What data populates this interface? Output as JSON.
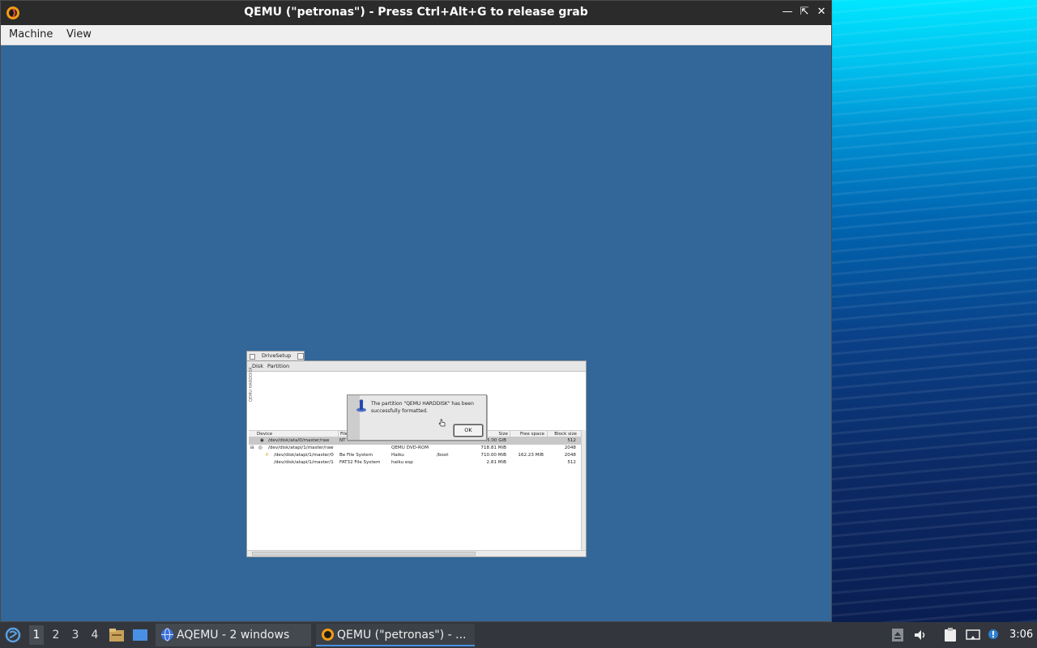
{
  "qemu_window": {
    "title": "QEMU (\"petronas\") - Press Ctrl+Alt+G to release grab",
    "menu": [
      "Machine",
      "View"
    ]
  },
  "drivesetup": {
    "title": "DriveSetup",
    "menu": [
      "Disk",
      "Partition"
    ],
    "disk_label": "QEMU HARDDISK",
    "columns": [
      "Device",
      "File",
      "Size",
      "Free space",
      "Block size"
    ],
    "rows": [
      {
        "device": "/dev/disk/ata/0/master/raw",
        "fs": "NT",
        "volume": "",
        "mount": "",
        "size": "5.00 GiB",
        "free": "",
        "block": "512"
      },
      {
        "device": "/dev/disk/atapi/1/master/raw",
        "fs": "",
        "volume": "QEMU DVD-ROM",
        "mount": "",
        "size": "718.81 MiB",
        "free": "",
        "block": "2048"
      },
      {
        "device": "/dev/disk/atapi/1/master/0",
        "fs": "Be File System",
        "volume": "Haiku",
        "mount": "/boot",
        "size": "710.00 MiB",
        "free": "162.23 MiB",
        "block": "2048"
      },
      {
        "device": "/dev/disk/atapi/1/master/1",
        "fs": "FAT32 File System",
        "volume": "haiku esp",
        "mount": "",
        "size": "2.81 MiB",
        "free": "",
        "block": "512"
      }
    ]
  },
  "alert": {
    "message": "The partition \"QEMU HARDDISK\" has been successfully formatted.",
    "ok_label": "OK"
  },
  "taskbar": {
    "workspaces": [
      "1",
      "2",
      "3",
      "4"
    ],
    "tasks": [
      {
        "label": "AQEMU - 2 windows"
      },
      {
        "label": "QEMU (\"petronas\") - ..."
      }
    ],
    "clock": "3:06"
  },
  "colors": {
    "guest_desktop": "#336699",
    "titlebar": "#2b2b2b",
    "taskbar": "#33373d"
  }
}
